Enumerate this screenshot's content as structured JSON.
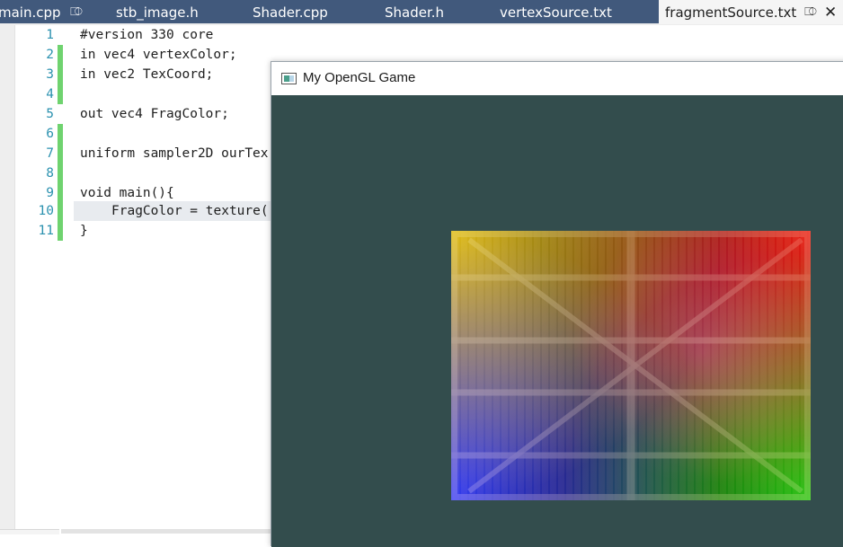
{
  "tabs": [
    {
      "label": "main.cpp",
      "pinned": true
    },
    {
      "label": "stb_image.h"
    },
    {
      "label": "Shader.cpp"
    },
    {
      "label": "Shader.h"
    },
    {
      "label": "vertexSource.txt"
    },
    {
      "label": "fragmentSource.txt",
      "active": true,
      "pinned": true,
      "closable": true
    }
  ],
  "icons": {
    "pin": "⎄",
    "close": "✕"
  },
  "editor": {
    "lines": [
      {
        "num": "1",
        "text": "#version 330 core",
        "changed": false
      },
      {
        "num": "2",
        "text": "in vec4 vertexColor;",
        "changed": true
      },
      {
        "num": "3",
        "text": "in vec2 TexCoord;",
        "changed": true
      },
      {
        "num": "4",
        "text": "",
        "changed": true
      },
      {
        "num": "5",
        "text": "out vec4 FragColor;",
        "changed": false
      },
      {
        "num": "6",
        "text": "",
        "changed": true
      },
      {
        "num": "7",
        "text": "uniform sampler2D ourTex",
        "changed": true
      },
      {
        "num": "8",
        "text": "",
        "changed": true
      },
      {
        "num": "9",
        "text": "void main(){",
        "changed": true
      },
      {
        "num": "10",
        "text": "FragColor = texture(",
        "changed": true,
        "indent": true
      },
      {
        "num": "11",
        "text": "}",
        "changed": true
      }
    ]
  },
  "gl_window": {
    "title": "My OpenGL Game",
    "clear_color": "#334d4d"
  },
  "colors": {
    "tabbar": "#41597c",
    "line_number": "#2b91af",
    "change_bar": "#6fd36f"
  }
}
